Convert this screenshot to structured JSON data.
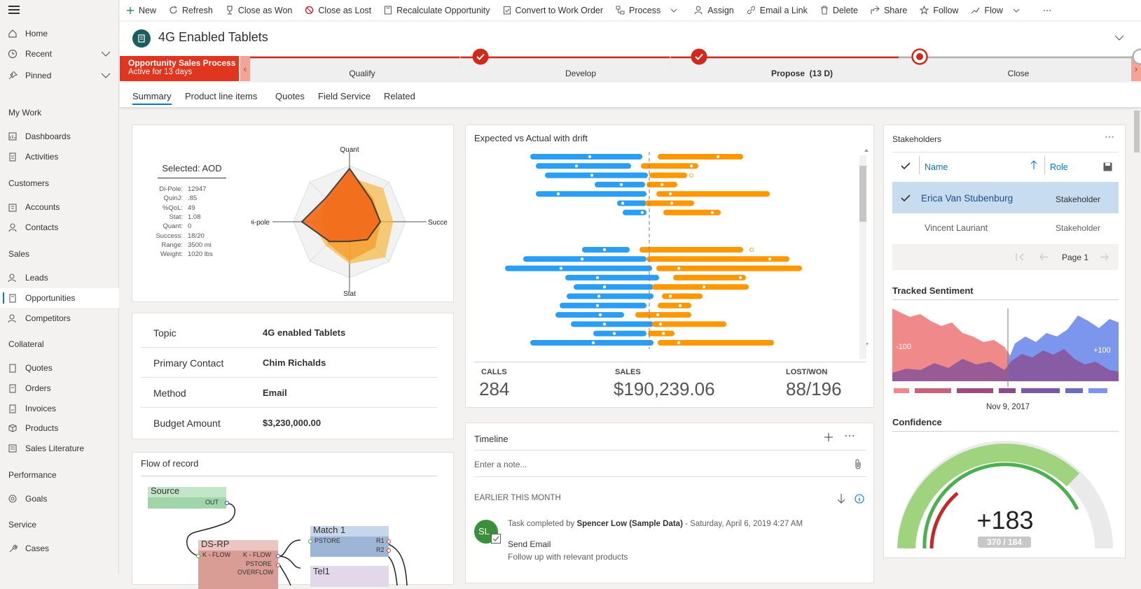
{
  "sidebar": {
    "home": "Home",
    "recent": "Recent",
    "pinned": "Pinned",
    "my_work": "My Work",
    "dashboards": "Dashboards",
    "activities": "Activities",
    "customers": "Customers",
    "accounts": "Accounts",
    "contacts": "Contacts",
    "sales": "Sales",
    "leads": "Leads",
    "opportunities": "Opportunities",
    "competitors": "Competitors",
    "collateral": "Collateral",
    "quotes": "Quotes",
    "orders": "Orders",
    "invoices": "Invoices",
    "products": "Products",
    "sales_literature": "Sales Literature",
    "performance": "Performance",
    "goals": "Goals",
    "service": "Service",
    "cases": "Cases"
  },
  "commands": {
    "new": "New",
    "refresh": "Refresh",
    "close_won": "Close as Won",
    "close_lost": "Close as Lost",
    "recalculate": "Recalculate Opportunity",
    "convert": "Convert to Work Order",
    "process": "Process",
    "assign": "Assign",
    "email_link": "Email a Link",
    "delete": "Delete",
    "share": "Share",
    "follow": "Follow",
    "flow": "Flow",
    "more": "⋯"
  },
  "record": {
    "title": "4G Enabled Tablets"
  },
  "process": {
    "name": "Opportunity Sales Process",
    "active": "Active for 13 days",
    "stages": [
      "Qualify",
      "Develop",
      "Propose  (13 D)",
      "Close"
    ]
  },
  "tabs": [
    "Summary",
    "Product line items",
    "Quotes",
    "Field Service",
    "Related"
  ],
  "radar": {
    "selected": "Selected: AOD",
    "axes": {
      "top": "Quant",
      "right": "Success",
      "bottom": "Stat",
      "left": "Di-pole"
    },
    "stats": [
      {
        "k": "Di-Pole:",
        "v": "12947"
      },
      {
        "k": "QuinJ:",
        "v": ".85"
      },
      {
        "k": "%QoL:",
        "v": "49"
      },
      {
        "k": "Stat:",
        "v": "1.08"
      },
      {
        "k": "Quant:",
        "v": "0"
      },
      {
        "k": "Success:",
        "v": "18/20"
      },
      {
        "k": "Range:",
        "v": "3500 mi"
      },
      {
        "k": "Weight:",
        "v": "1020 lbs"
      }
    ]
  },
  "fields": [
    {
      "label": "Topic",
      "value": "4G enabled Tablets"
    },
    {
      "label": "Primary Contact",
      "value": "Chim Richalds"
    },
    {
      "label": "Method",
      "value": "Email"
    },
    {
      "label": "Budget Amount",
      "value": "$3,230,000.00"
    }
  ],
  "flow": {
    "title": "Flow of record",
    "source": "Source",
    "out": "OUT",
    "dsrp": "DS-RP",
    "kflow_in": "K - FLOW",
    "kflow_out": "K - FLOW",
    "pstore": "PSTORE",
    "overflow": "OVERFLOW",
    "match": "Match 1",
    "match_in": "PSTORE",
    "r1": "R1",
    "r2": "R2",
    "tel": "Tel1"
  },
  "drift": {
    "title": "Expected vs Actual with drift",
    "stats": [
      {
        "label": "CALLS",
        "value": "284"
      },
      {
        "label": "SALES",
        "value": "$190,239.06"
      },
      {
        "label": "LOST/WON",
        "value": "88/196"
      }
    ]
  },
  "timeline": {
    "title": "Timeline",
    "note_placeholder": "Enter a note...",
    "group": "EARLIER THIS MONTH",
    "item_prefix": "Task completed by",
    "item_user": "Spencer Low (Sample Data)",
    "item_date": "Saturday, April 6, 2019 4:27 AM",
    "item_title": "Send Email",
    "item_desc": "Follow up with relevant products",
    "avatar": "SL"
  },
  "stakeholders": {
    "title": "Stakeholders",
    "col_name": "Name",
    "col_role": "Role",
    "rows": [
      {
        "name": "Erica Van Stubenburg",
        "role": "Stakeholder"
      },
      {
        "name": "Vincent Lauriant",
        "role": "Stakeholder"
      }
    ],
    "page": "Page 1"
  },
  "sentiment": {
    "title": "Tracked Sentiment",
    "low": "-100",
    "high": "+100",
    "date": "Nov 9, 2017"
  },
  "confidence": {
    "title": "Confidence",
    "value": "+183",
    "ratio": "370 / 184"
  },
  "colors": {
    "accent": "#0078d4",
    "process_red": "#e0351f",
    "blue_bar": "#2a9df4",
    "orange_bar": "#ff9800",
    "stake_selected": "#c7dcee"
  }
}
